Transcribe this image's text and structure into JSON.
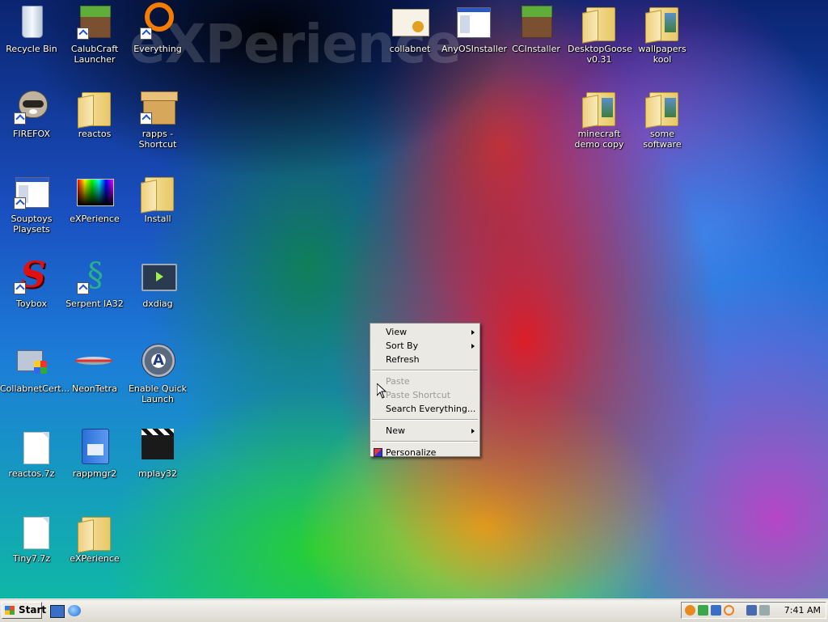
{
  "desktop": {
    "watermark": "eXPerience",
    "icons": [
      {
        "label": "Recycle Bin"
      },
      {
        "label": "CalubCraft Launcher"
      },
      {
        "label": "Everything"
      },
      {
        "label": "FIREFOX"
      },
      {
        "label": "reactos"
      },
      {
        "label": "rapps - Shortcut"
      },
      {
        "label": "Souptoys Playsets"
      },
      {
        "label": "eXPerience"
      },
      {
        "label": "Install"
      },
      {
        "label": "Toybox"
      },
      {
        "label": "Serpent IA32"
      },
      {
        "label": "dxdiag"
      },
      {
        "label": "CollabnetCert..."
      },
      {
        "label": "NeonTetra"
      },
      {
        "label": "Enable Quick Launch"
      },
      {
        "label": "reactos.7z"
      },
      {
        "label": "rappmgr2"
      },
      {
        "label": "mplay32"
      },
      {
        "label": "Tiny7.7z"
      },
      {
        "label": "eXPerience"
      },
      {
        "label": "collabnet"
      },
      {
        "label": "AnyOSInstaller"
      },
      {
        "label": "CCInstaller"
      },
      {
        "label": "DesktopGoose v0.31"
      },
      {
        "label": "wallpapers kool"
      },
      {
        "label": "minecraft demo copy"
      },
      {
        "label": "some software"
      }
    ]
  },
  "context_menu": {
    "view": "View",
    "sort_by": "Sort By",
    "refresh": "Refresh",
    "paste": "Paste",
    "paste_shortcut": "Paste Shortcut",
    "search_everything": "Search Everything...",
    "new": "New",
    "personalize": "Personalize"
  },
  "taskbar": {
    "start_label": "Start",
    "clock": "7:41 AM"
  }
}
